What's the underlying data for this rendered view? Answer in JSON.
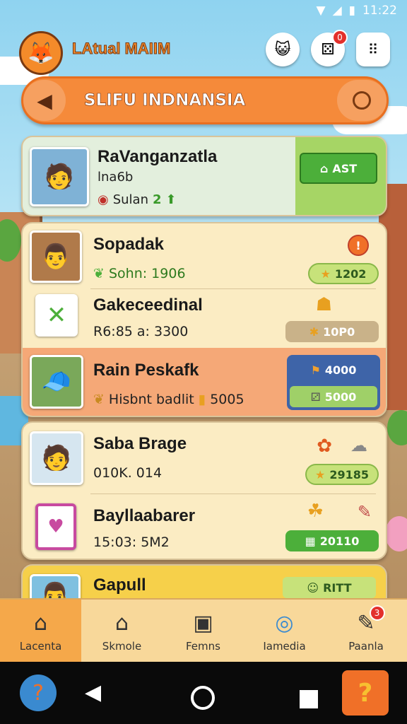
{
  "status": {
    "time": "11:22"
  },
  "header": {
    "app_title": "LAtual MAIIM"
  },
  "banner": {
    "title": "SLIFU INDNANSIA",
    "back_icon": "back-arrow-icon"
  },
  "header_buttons": {
    "notification_count": "0"
  },
  "cards": [
    {
      "name": "RaVanganzatla",
      "sub1": "lna6b",
      "sub2": "Sulan",
      "sub2_num": "2",
      "button": "AST"
    },
    {
      "name": "Sopadak",
      "sub": "Sohn: 1906",
      "pill": "1202"
    },
    {
      "name": "Gakeceedinal",
      "sub": "R6:85 a: 3300",
      "pill": "10P0"
    },
    {
      "name": "Rain Peskafk",
      "sub": "Hisbnt badlit",
      "sub_num": "5005",
      "pill1": "4000",
      "pill2": "5000"
    },
    {
      "name": "Saba Brage",
      "sub": "010K. 014",
      "pill": "29185"
    },
    {
      "name": "Bayllaabarer",
      "sub": "15:03: 5M2",
      "pill": "20110"
    },
    {
      "name": "Gapull",
      "pill": "RITT"
    }
  ],
  "nav": [
    {
      "label": "Lacenta"
    },
    {
      "label": "Skmole"
    },
    {
      "label": "Femns"
    },
    {
      "label": "Iamedia"
    },
    {
      "label": "Paanla",
      "badge": "3"
    }
  ],
  "colors": {
    "accent": "#f58a3a",
    "green": "#4caf3a",
    "highlight": "#f7a877"
  }
}
